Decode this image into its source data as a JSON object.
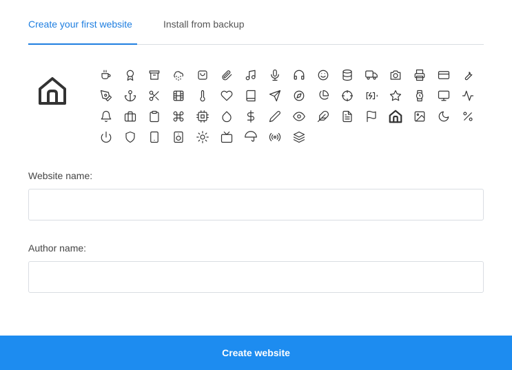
{
  "tabs": [
    {
      "label": "Create your first website",
      "active": true
    },
    {
      "label": "Install from backup",
      "active": false
    }
  ],
  "selected_icon": "house-icon",
  "icons": [
    "coffee-cup-icon",
    "award-icon",
    "archive-icon",
    "cloud-drizzle-icon",
    "shopping-bag-icon",
    "paperclip-icon",
    "music-note-icon",
    "microphone-icon",
    "headphones-icon",
    "smiley-icon",
    "database-icon",
    "truck-icon",
    "camera-icon",
    "printer-icon",
    "credit-card-icon",
    "wrench-icon",
    "pen-tool-icon",
    "anchor-icon",
    "scissors-icon",
    "film-icon",
    "thermometer-icon",
    "heart-icon",
    "book-icon",
    "send-icon",
    "compass-icon",
    "pie-chart-icon",
    "crosshair-icon",
    "battery-charging-icon",
    "star-icon",
    "watch-icon",
    "monitor-icon",
    "activity-icon",
    "bell-icon",
    "briefcase-icon",
    "clipboard-icon",
    "command-icon",
    "cpu-icon",
    "droplet-icon",
    "dollar-icon",
    "pencil-icon",
    "eye-icon",
    "feather-icon",
    "file-text-icon",
    "flag-icon",
    "house-icon",
    "image-icon",
    "moon-icon",
    "percent-icon",
    "power-icon",
    "shield-icon",
    "tablet-icon",
    "speaker-icon",
    "sun-icon",
    "tv-icon",
    "umbrella-icon",
    "radio-icon",
    "layers-icon"
  ],
  "form": {
    "website_label": "Website name:",
    "website_value": "",
    "author_label": "Author name:",
    "author_value": ""
  },
  "create_button": "Create website",
  "colors": {
    "accent": "#1e7ee0",
    "button": "#1d8cf0",
    "border": "#d9dde2",
    "icon": "#333333"
  }
}
